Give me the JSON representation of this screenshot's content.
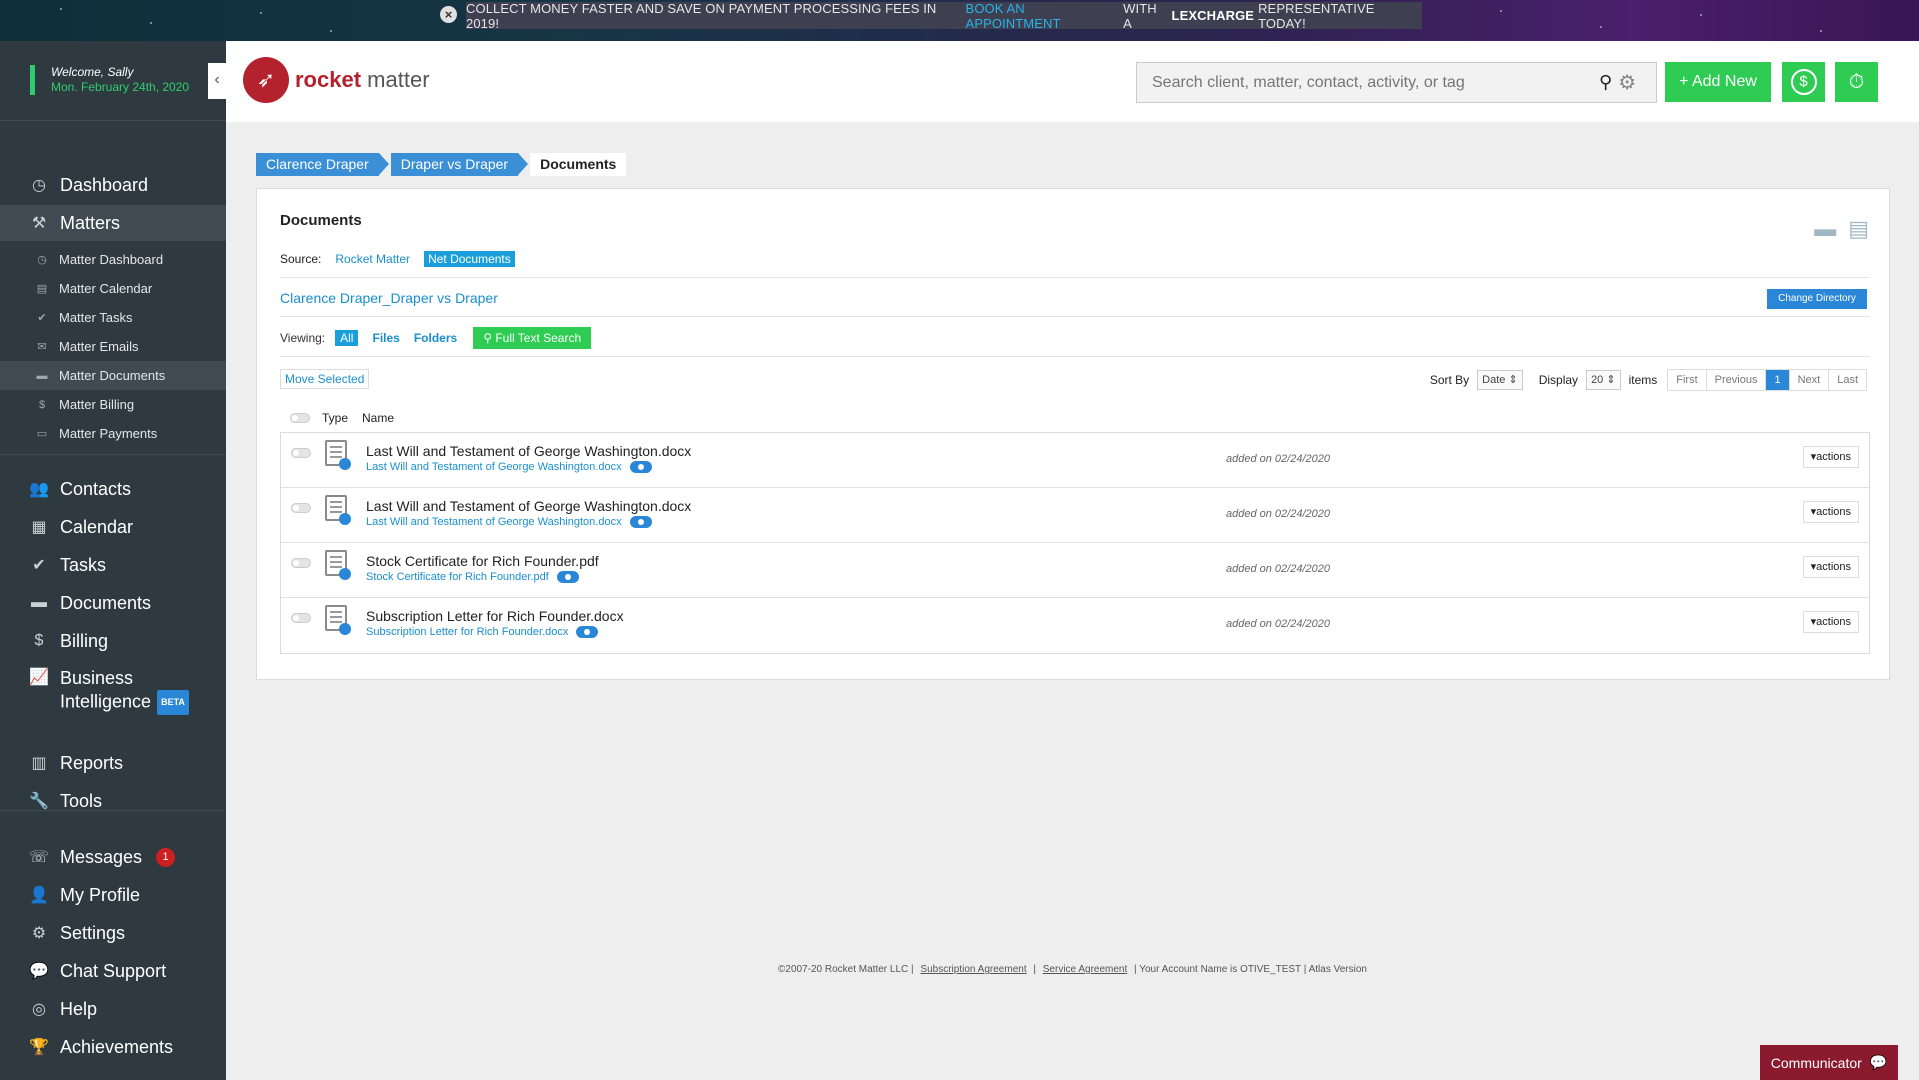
{
  "banner": {
    "text_pre": "COLLECT MONEY FASTER AND SAVE ON PAYMENT PROCESSING FEES IN 2019!",
    "link": "BOOK AN APPOINTMENT",
    "text_mid": "WITH A",
    "brand": "LEXCHARGE",
    "text_post": "REPRESENTATIVE TODAY!",
    "close_icon": "×"
  },
  "welcome": {
    "greeting": "Welcome, Sally",
    "date": "Mon. February 24th, 2020"
  },
  "sidebar": {
    "collapse_icon": "‹",
    "main": [
      {
        "label": "Dashboard",
        "icon": "◷"
      },
      {
        "label": "Matters",
        "icon": "⚒"
      }
    ],
    "matter_sub": [
      {
        "label": "Matter Dashboard",
        "icon": "◷"
      },
      {
        "label": "Matter Calendar",
        "icon": "▤"
      },
      {
        "label": "Matter Tasks",
        "icon": "✔"
      },
      {
        "label": "Matter Emails",
        "icon": "✉"
      },
      {
        "label": "Matter Documents",
        "icon": "▬"
      },
      {
        "label": "Matter Billing",
        "icon": "$"
      },
      {
        "label": "Matter Payments",
        "icon": "▭"
      }
    ],
    "items": [
      {
        "label": "Contacts",
        "icon": "👥"
      },
      {
        "label": "Calendar",
        "icon": "▦"
      },
      {
        "label": "Tasks",
        "icon": "✔"
      },
      {
        "label": "Documents",
        "icon": "▬"
      },
      {
        "label": "Billing",
        "icon": "$"
      },
      {
        "label": "Business",
        "label2": "Intelligence",
        "badge": "BETA",
        "icon": "📈"
      },
      {
        "label": "Reports",
        "icon": "▥"
      },
      {
        "label": "Tools",
        "icon": "🔧"
      }
    ],
    "bottom": [
      {
        "label": "Messages",
        "icon": "☏",
        "badge": "1"
      },
      {
        "label": "My Profile",
        "icon": "👤"
      },
      {
        "label": "Settings",
        "icon": "⚙"
      },
      {
        "label": "Chat Support",
        "icon": "💬"
      },
      {
        "label": "Help",
        "icon": "◎"
      },
      {
        "label": "Achievements",
        "icon": "🏆"
      }
    ]
  },
  "header": {
    "logo_word1": "rocket",
    "logo_word2": "matter",
    "search_placeholder": "Search client, matter, contact, activity, or tag",
    "add_new": "+ Add New",
    "billing_icon": "$",
    "timer_icon": "⏱"
  },
  "breadcrumbs": [
    "Clarence Draper",
    "Draper vs Draper",
    "Documents"
  ],
  "panel": {
    "title": "Documents",
    "source_label": "Source:",
    "source_rm": "Rocket Matter",
    "source_nd": "Net Documents",
    "path": "Clarence Draper_Draper vs Draper",
    "change_directory": "Change Directory",
    "viewing_label": "Viewing:",
    "view_all": "All",
    "view_files": "Files",
    "view_folders": "Folders",
    "full_text_search": "Full Text Search",
    "move_selected": "Move Selected",
    "sort_by": "Sort By",
    "sort_value": "Date",
    "display": "Display",
    "display_value": "20",
    "items": "items",
    "pager": [
      "First",
      "Previous",
      "1",
      "Next",
      "Last"
    ],
    "col_type": "Type",
    "col_name": "Name",
    "actions": "actions",
    "rows": [
      {
        "name": "Last Will and Testament of George Washington.docx",
        "link": "Last Will and Testament of George Washington.docx",
        "added": "added on 02/24/2020"
      },
      {
        "name": "Last Will and Testament of George Washington.docx",
        "link": "Last Will and Testament of George Washington.docx",
        "added": "added on 02/24/2020"
      },
      {
        "name": "Stock Certificate for Rich Founder.pdf",
        "link": "Stock Certificate for Rich Founder.pdf",
        "added": "added on 02/24/2020"
      },
      {
        "name": "Subscription Letter for Rich Founder.docx",
        "link": "Subscription Letter for Rich Founder.docx",
        "added": "added on 02/24/2020"
      }
    ]
  },
  "footer": {
    "copy": "©2007-20 Rocket Matter LLC |",
    "sub": "Subscription Agreement",
    "sep": "|",
    "svc": "Service Agreement",
    "tail": "| Your Account Name is OTIVE_TEST | Atlas Version"
  },
  "communicator": "Communicator"
}
